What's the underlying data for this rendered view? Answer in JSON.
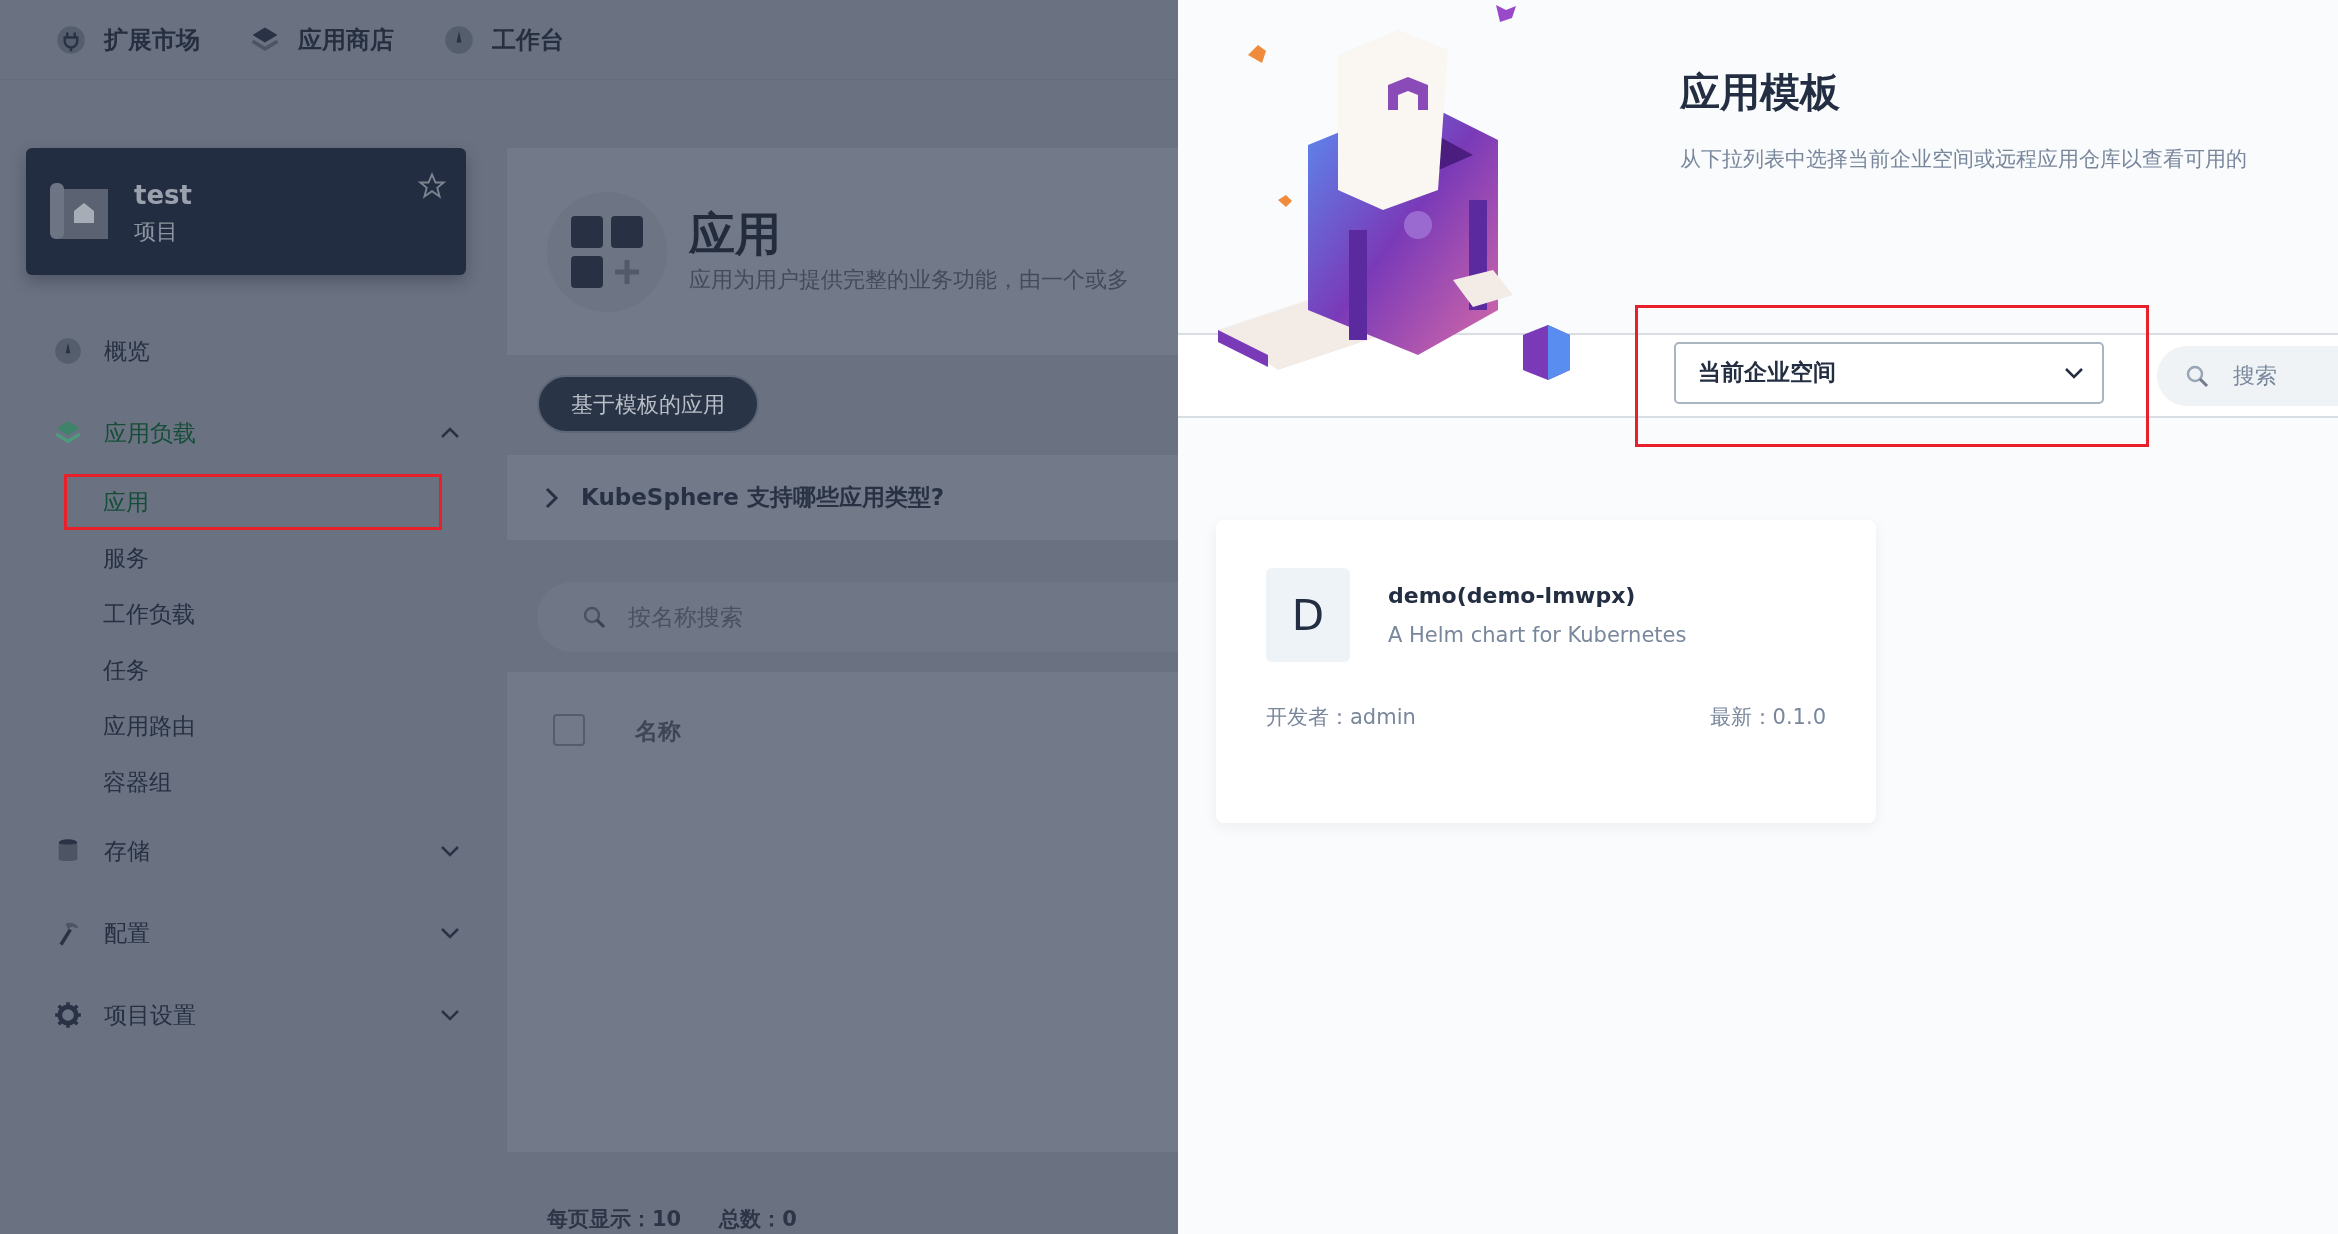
{
  "top_nav": [
    {
      "label": "扩展市场"
    },
    {
      "label": "应用商店"
    },
    {
      "label": "工作台"
    }
  ],
  "project": {
    "name": "test",
    "type": "项目",
    "starred": false
  },
  "sidebar": [
    {
      "label": "概览",
      "kind": "link"
    },
    {
      "label": "应用负载",
      "kind": "group",
      "expanded": true,
      "active": true,
      "children": [
        {
          "label": "应用",
          "selected": true,
          "highlighted": true
        },
        {
          "label": "服务",
          "selected": false,
          "highlighted": false
        },
        {
          "label": "工作负载",
          "selected": false,
          "highlighted": false
        },
        {
          "label": "任务",
          "selected": false,
          "highlighted": false
        },
        {
          "label": "应用路由",
          "selected": false,
          "highlighted": false
        },
        {
          "label": "容器组",
          "selected": false,
          "highlighted": false
        }
      ]
    },
    {
      "label": "存储",
      "kind": "group",
      "expanded": false,
      "active": false
    },
    {
      "label": "配置",
      "kind": "group",
      "expanded": false,
      "active": false
    },
    {
      "label": "项目设置",
      "kind": "group",
      "expanded": false,
      "active": false
    }
  ],
  "page": {
    "title": "应用",
    "description": "应用为用户提供完整的业务功能，由一个或多",
    "tabs": [
      {
        "label": "基于模板的应用",
        "selected": true
      }
    ],
    "faq": "KubeSphere 支持哪些应用类型?",
    "search": {
      "placeholder": "按名称搜索"
    },
    "table": {
      "select_all": {
        "checked": false
      },
      "columns": [
        "名称"
      ]
    },
    "footer": {
      "page_size": "每页显示：10",
      "total": "总数：0"
    }
  },
  "drawer": {
    "title": "应用模板",
    "description": "从下拉列表中选择当前企业空间或远程应用仓库以查看可用的",
    "repo_select": {
      "value": "当前企业空间",
      "highlighted": true
    },
    "search": {
      "placeholder": "搜索"
    },
    "apps": [
      {
        "initial": "D",
        "name": "demo(demo-lmwpx)",
        "description": "A Helm chart for Kubernetes",
        "developer": "开发者：admin",
        "latest": "最新：0.1.0"
      }
    ]
  }
}
